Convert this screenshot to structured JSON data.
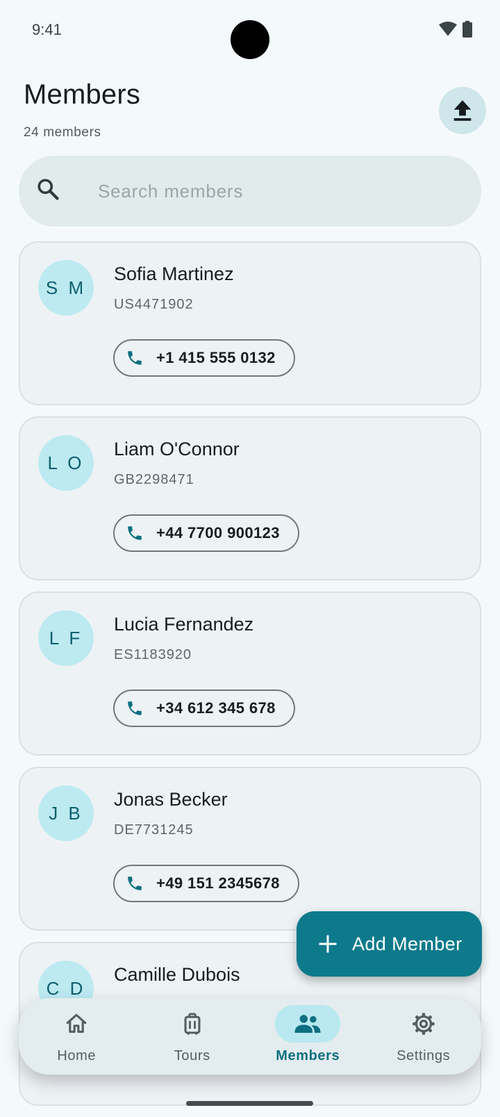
{
  "status_bar": {
    "time": "9:41"
  },
  "header": {
    "title": "Members",
    "subtitle": "24 members"
  },
  "search": {
    "placeholder": "Search members",
    "value": ""
  },
  "members": [
    {
      "initials": "S M",
      "name": "Sofia Martinez",
      "id": "US4471902",
      "phone": "+1 415 555 0132"
    },
    {
      "initials": "L O",
      "name": "Liam O'Connor",
      "id": "GB2298471",
      "phone": "+44 7700 900123"
    },
    {
      "initials": "L F",
      "name": "Lucia Fernandez",
      "id": "ES1183920",
      "phone": "+34 612 345 678"
    },
    {
      "initials": "J B",
      "name": "Jonas Becker",
      "id": "DE7731245",
      "phone": "+49 151 2345678"
    },
    {
      "initials": "C D",
      "name": "Camille Dubois",
      "id": "",
      "phone": ""
    }
  ],
  "fab": {
    "label": "Add Member",
    "icon": "plus-icon"
  },
  "nav": {
    "items": [
      {
        "label": "Home",
        "icon": "home-icon",
        "active": false
      },
      {
        "label": "Tours",
        "icon": "luggage-icon",
        "active": false
      },
      {
        "label": "Members",
        "icon": "group-icon",
        "active": true
      },
      {
        "label": "Settings",
        "icon": "gear-icon",
        "active": false
      }
    ]
  },
  "colors": {
    "accent": "#0d7a8c",
    "avatar_bg": "#bdeaf1",
    "nav_active_pill": "#b9e8f0",
    "card_bg": "#edf2f5",
    "background": "#f4fafb"
  }
}
